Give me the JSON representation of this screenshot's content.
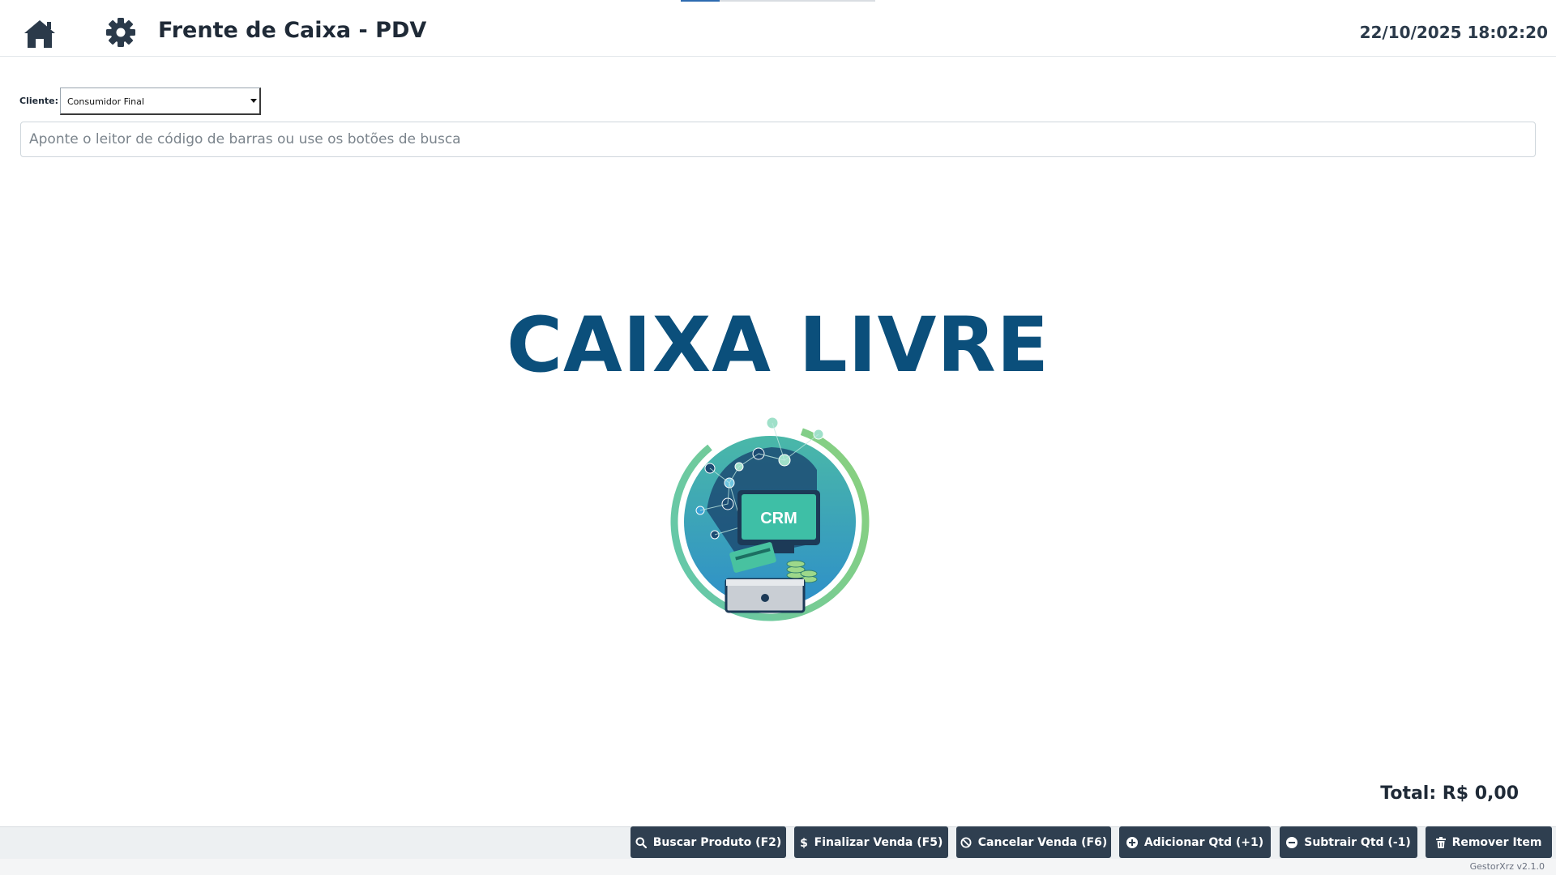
{
  "header": {
    "title": "Frente de Caixa - PDV",
    "datetime": "22/10/2025 18:02:20"
  },
  "client": {
    "label": "Cliente:",
    "selected": "Consumidor Final"
  },
  "search": {
    "placeholder": "Aponte o leitor de código de barras ou use os botões de busca",
    "value": ""
  },
  "main": {
    "status_text": "CAIXA LIVRE",
    "logo_text": "CRM"
  },
  "total": {
    "text": "Total: R$ 0,00"
  },
  "toolbar": {
    "buttons": [
      {
        "label": "Buscar Produto (F2)",
        "icon": "search-icon"
      },
      {
        "label": "Finalizar Venda (F5)",
        "icon": "dollar-icon"
      },
      {
        "label": "Cancelar Venda (F6)",
        "icon": "ban-icon"
      },
      {
        "label": "Adicionar Qtd (+1)",
        "icon": "plus-circle-icon"
      },
      {
        "label": "Subtrair Qtd (-1)",
        "icon": "minus-circle-icon"
      },
      {
        "label": "Remover Item",
        "icon": "trash-icon"
      }
    ]
  },
  "footer": {
    "version": "GestorXrz v2.1.0"
  },
  "colors": {
    "brand_title": "#0b4f7b",
    "button_bg": "#2f3f50",
    "text_dark": "#1f2a37"
  }
}
